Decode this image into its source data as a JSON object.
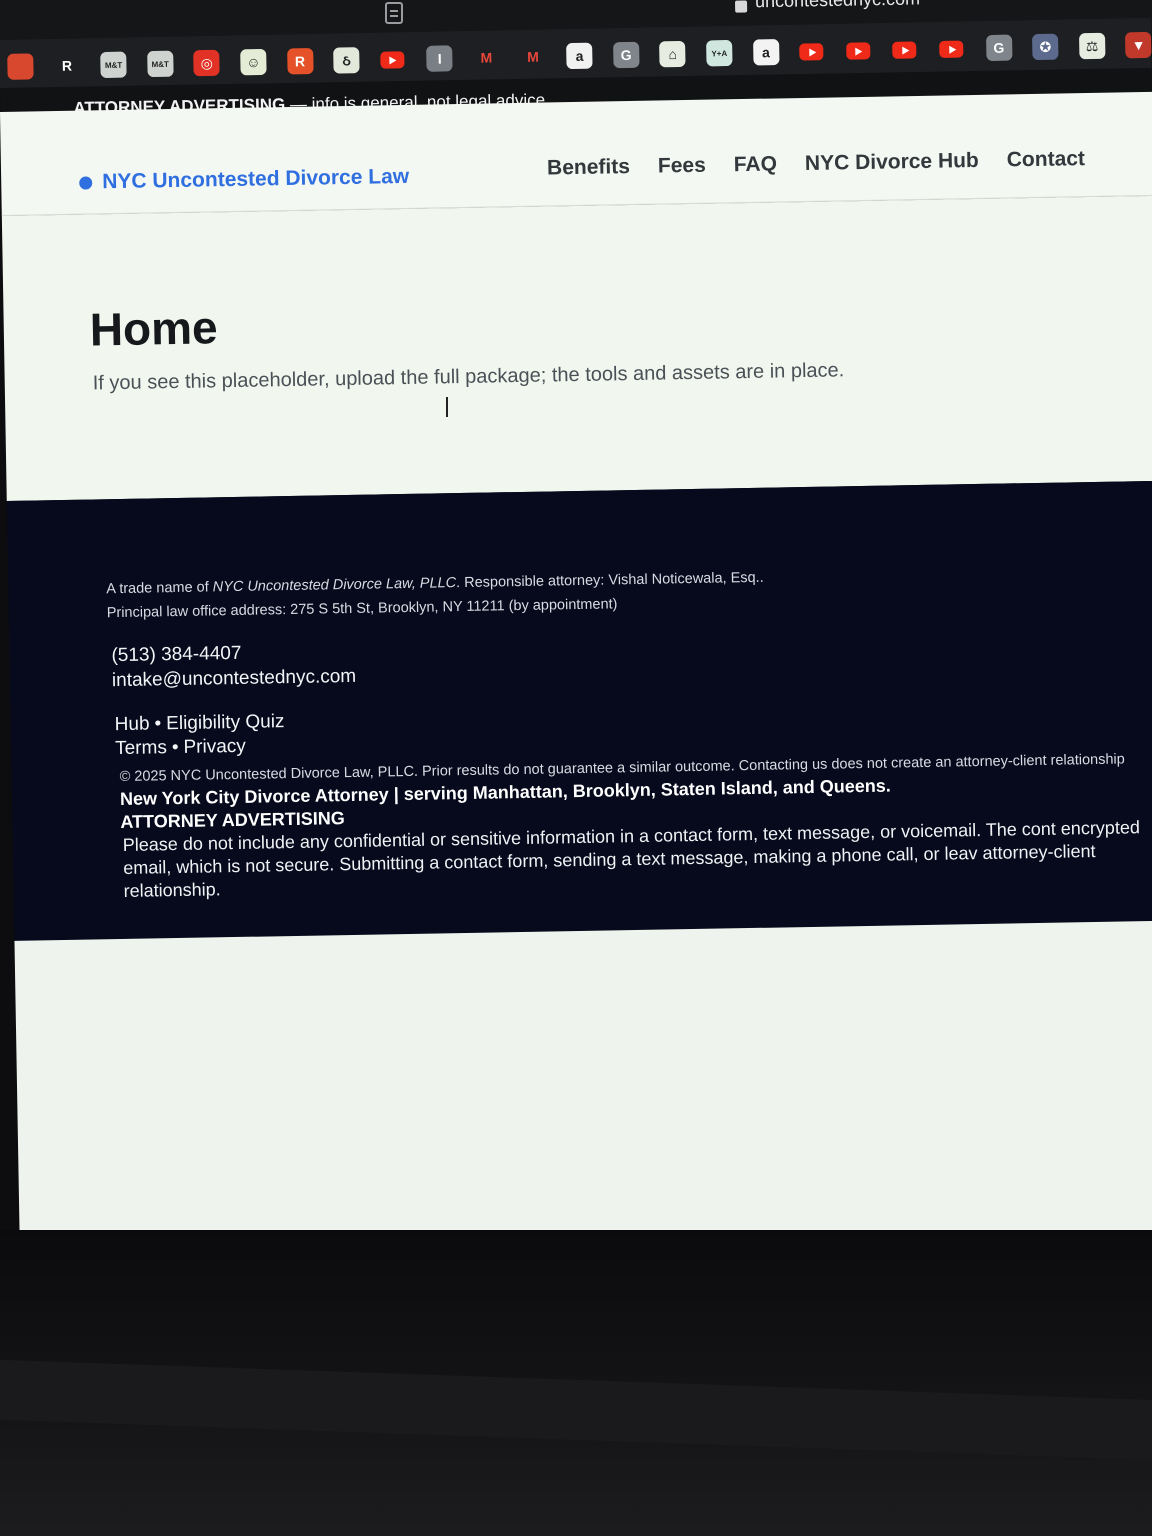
{
  "browser": {
    "url": "uncontestednyc.com",
    "bookmarks": [
      {
        "icon": "puzzle-icon",
        "label": "",
        "color": "#d8482e"
      },
      {
        "icon": "r-letter-icon",
        "label": "R",
        "color": "#1e1f22"
      },
      {
        "icon": "mt-icon",
        "label": "M&T",
        "color": "#cfd3cf"
      },
      {
        "icon": "mt-icon",
        "label": "M&T",
        "color": "#cfd3cf"
      },
      {
        "icon": "target-icon",
        "label": "◎",
        "color": "#e23226"
      },
      {
        "icon": "smile-icon",
        "label": "☺",
        "color": "#e5ecd5"
      },
      {
        "icon": "r-square-icon",
        "label": "R",
        "color": "#e5522a"
      },
      {
        "icon": "swirl-icon",
        "label": "ઠ",
        "color": "#e2e8da"
      },
      {
        "icon": "youtube-icon",
        "label": "",
        "color": "#ef2a18"
      },
      {
        "icon": "info-icon",
        "label": "I",
        "color": "#7a7f86"
      },
      {
        "icon": "gmail-icon",
        "label": "M",
        "color": "#1e1f22"
      },
      {
        "icon": "gmail-icon",
        "label": "M",
        "color": "#1e1f22"
      },
      {
        "icon": "a-circle-icon",
        "label": "a",
        "color": "#f1f1f1"
      },
      {
        "icon": "g-icon",
        "label": "G",
        "color": "#7f858b"
      },
      {
        "icon": "state-map-icon",
        "label": "⌂",
        "color": "#e6ece0"
      },
      {
        "icon": "yplus-icon",
        "label": "Y+A",
        "color": "#cfe7df"
      },
      {
        "icon": "amazon-icon",
        "label": "a",
        "color": "#f3f3f3"
      },
      {
        "icon": "youtube-icon",
        "label": "",
        "color": "#ef2a18"
      },
      {
        "icon": "youtube-icon",
        "label": "",
        "color": "#ef2a18"
      },
      {
        "icon": "youtube-icon",
        "label": "",
        "color": "#ef2a18"
      },
      {
        "icon": "youtube-icon",
        "label": "",
        "color": "#ef2a18"
      },
      {
        "icon": "g-icon",
        "label": "G",
        "color": "#7f858b"
      },
      {
        "icon": "seal-icon",
        "label": "✪",
        "color": "#5b6a8d"
      },
      {
        "icon": "scales-icon",
        "label": "⚖",
        "color": "#e6ece0"
      },
      {
        "icon": "flag-icon",
        "label": "▼",
        "color": "#c0392b"
      }
    ]
  },
  "ad_bar": {
    "strong": "ATTORNEY ADVERTISING",
    "rest": " — info is general, not legal advice."
  },
  "header": {
    "logo": "NYC Uncontested Divorce Law",
    "brand_color": "#2f6fe0",
    "nav": [
      "Benefits",
      "Fees",
      "FAQ",
      "NYC Divorce Hub",
      "Contact"
    ]
  },
  "hero": {
    "title": "Home",
    "subtitle": "If you see this placeholder, upload the full package; the tools and assets are in place."
  },
  "footer": {
    "trade_prefix": "A trade name of ",
    "trade_name": "NYC Uncontested Divorce Law, PLLC",
    "trade_suffix": ". Responsible attorney: Vishal Noticewala, Esq..",
    "office": "Principal law office address: 275 S 5th St, Brooklyn, NY 11211 (by appointment)",
    "phone": "(513) 384-4407",
    "email": "intake@uncontestednyc.com",
    "links_row1": [
      "Hub",
      "Eligibility Quiz"
    ],
    "links_row2": [
      "Terms",
      "Privacy"
    ],
    "separator": "•",
    "copyright": "© 2025 NYC Uncontested Divorce Law, PLLC. Prior results do not guarantee a similar outcome. Contacting us does not create an attorney-client relationship",
    "tagline": "New York City Divorce Attorney | serving Manhattan, Brooklyn, Staten Island, and Queens.",
    "advertising": "ATTORNEY ADVERTISING",
    "disclaimer": "Please do not include any confidential or sensitive information in a contact form, text message, or voicemail. The cont encrypted email, which is not secure. Submitting a contact form, sending a text message, making a phone call, or leav attorney-client relationship.",
    "bg_color": "#060a1c"
  }
}
